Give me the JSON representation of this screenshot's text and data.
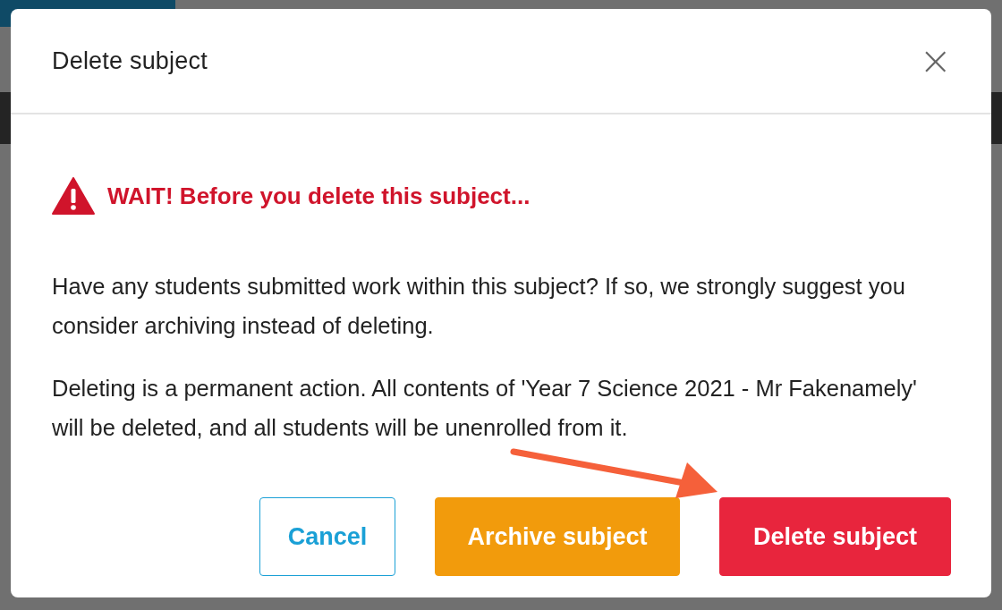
{
  "dialog": {
    "title": "Delete subject",
    "close_icon": "×",
    "warning": "WAIT! Before you delete this subject...",
    "paragraphs": [
      "Have any students submitted work within this subject? If so, we strongly suggest you consider archiving instead of deleting.",
      "Deleting is a permanent action. All contents of 'Year 7 Science 2021 - Mr Fakenamely' will be deleted, and all students will be unenrolled from it."
    ],
    "buttons": [
      {
        "label": "Cancel",
        "kind": "outline"
      },
      {
        "label": "Archive subject",
        "kind": "warning"
      },
      {
        "label": "Delete subject",
        "kind": "danger"
      }
    ]
  },
  "annotation": {
    "kind": "arrow"
  }
}
